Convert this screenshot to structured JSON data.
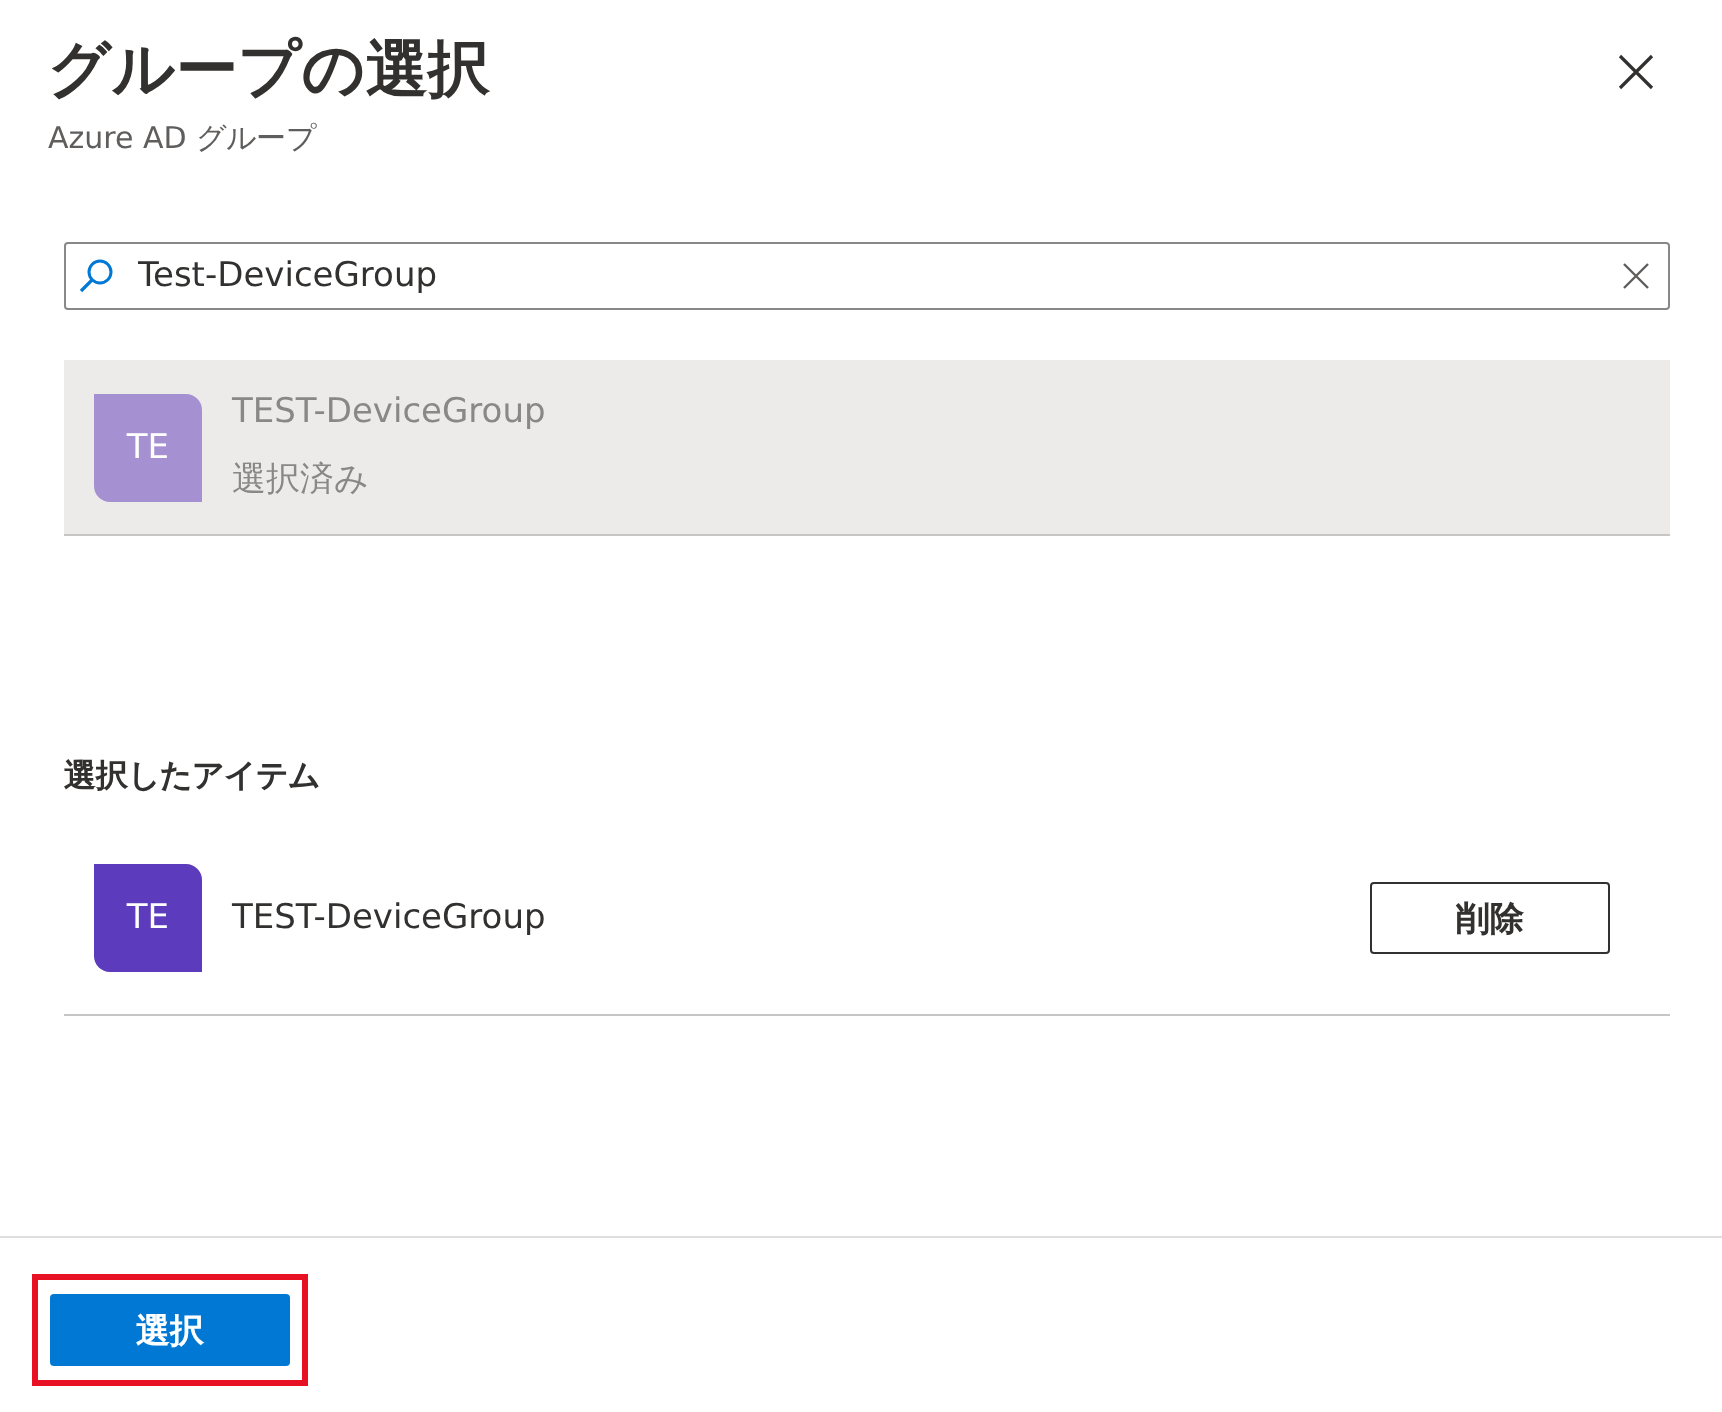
{
  "header": {
    "title": "グループの選択",
    "subtitle": "Azure AD グループ"
  },
  "search": {
    "value": "Test-DeviceGroup"
  },
  "results": [
    {
      "initials": "TE",
      "name": "TEST-DeviceGroup",
      "status": "選択済み",
      "disabled": true
    }
  ],
  "selected_section": {
    "heading": "選択したアイテム",
    "items": [
      {
        "initials": "TE",
        "name": "TEST-DeviceGroup",
        "action": "削除"
      }
    ]
  },
  "footer": {
    "button": {
      "label": "選択",
      "highlighted": true
    }
  }
}
